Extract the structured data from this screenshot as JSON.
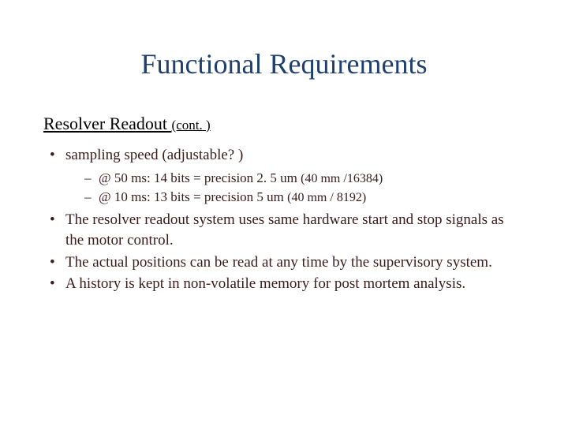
{
  "title": "Functional Requirements",
  "subtitle": {
    "main": "Resolver Readout ",
    "cont": "(cont. )"
  },
  "bullets": {
    "b1": "sampling speed (adjustable? )",
    "sub1_text": "@ 50 ms: 14 bits = precision 2. 5 um   ",
    "sub1_paren": "(40 mm /16384)",
    "sub2_text": "@ 10 ms: 13 bits = precision 5    um   ",
    "sub2_paren": "(40 mm /  8192)",
    "b2": "The resolver readout system uses same hardware start and stop signals as the motor control.",
    "b3": "The actual positions can be read at any time by the supervisory system.",
    "b4": "A history is kept in non-volatile memory for post mortem analysis."
  }
}
